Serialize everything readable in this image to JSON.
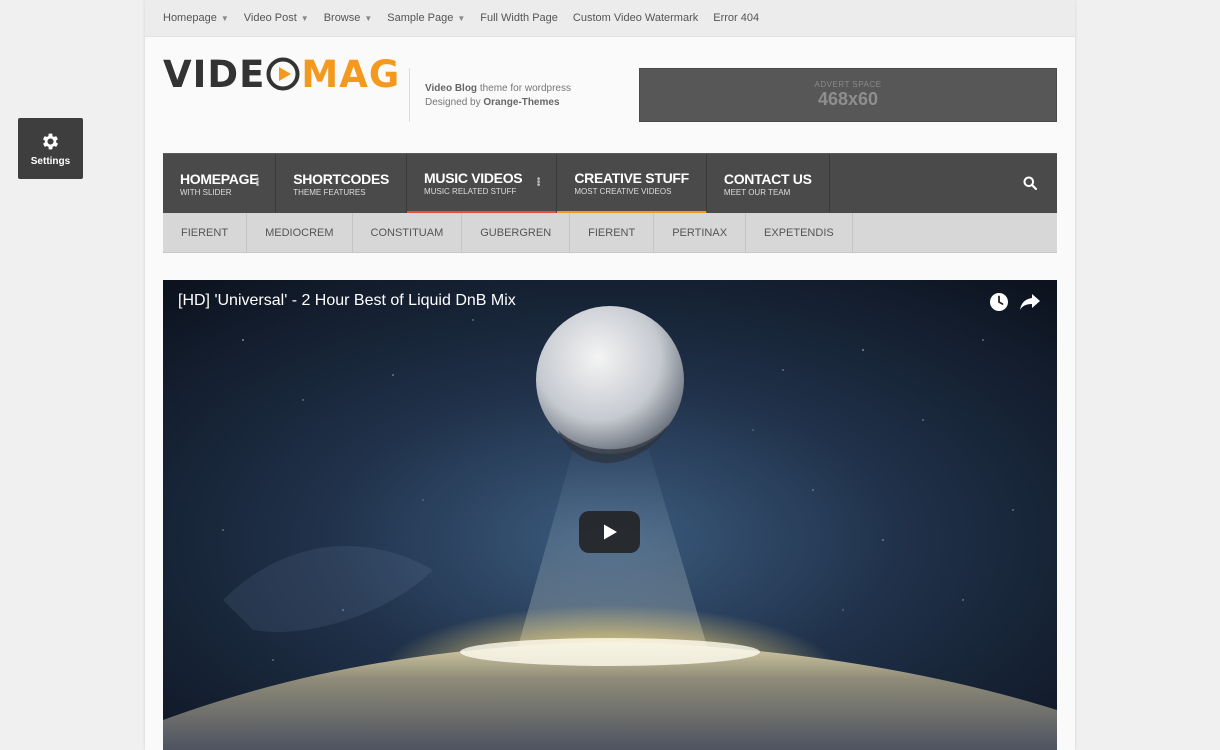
{
  "settings": {
    "label": "Settings",
    "icon": "gear-icon"
  },
  "topbar": {
    "items": [
      {
        "label": "Homepage",
        "has_dropdown": true
      },
      {
        "label": "Video Post",
        "has_dropdown": true
      },
      {
        "label": "Browse",
        "has_dropdown": true
      },
      {
        "label": "Sample Page",
        "has_dropdown": true
      },
      {
        "label": "Full Width Page",
        "has_dropdown": false
      },
      {
        "label": "Custom Video Watermark",
        "has_dropdown": false
      },
      {
        "label": "Error 404",
        "has_dropdown": false
      }
    ]
  },
  "logo": {
    "part1": "VIDE",
    "part2": "MAG",
    "colors": {
      "dark": "#333333",
      "accent": "#f39a1e"
    }
  },
  "tagline": {
    "line1_bold": "Video Blog",
    "line1_rest": " theme for wordpress",
    "line2_prefix": "Designed by ",
    "line2_bold": "Orange-Themes"
  },
  "advert": {
    "label": "ADVERT SPACE",
    "size": "468x60"
  },
  "main_nav": {
    "items": [
      {
        "title": "HOMEPAGE",
        "subtitle": "WITH SLIDER",
        "has_submenu": true,
        "accent": ""
      },
      {
        "title": "SHORTCODES",
        "subtitle": "THEME FEATURES",
        "has_submenu": false,
        "accent": ""
      },
      {
        "title": "MUSIC VIDEOS",
        "subtitle": "MUSIC RELATED STUFF",
        "has_submenu": true,
        "accent": "#e74c3c"
      },
      {
        "title": "CREATIVE STUFF",
        "subtitle": "MOST CREATIVE VIDEOS",
        "has_submenu": false,
        "accent": "#f39a1e"
      },
      {
        "title": "CONTACT US",
        "subtitle": "MEET OUR TEAM",
        "has_submenu": false,
        "accent": ""
      }
    ],
    "search_icon": "search-icon"
  },
  "sub_nav": {
    "items": [
      "FIERENT",
      "MEDIOCREM",
      "CONSTITUAM",
      "GUBERGREN",
      "FIERENT",
      "PERTINAX",
      "EXPETENDIS"
    ]
  },
  "video": {
    "title": "[HD] 'Universal' - 2 Hour Best of Liquid DnB Mix",
    "icons": [
      "clock-icon",
      "share-icon",
      "play-icon"
    ]
  }
}
